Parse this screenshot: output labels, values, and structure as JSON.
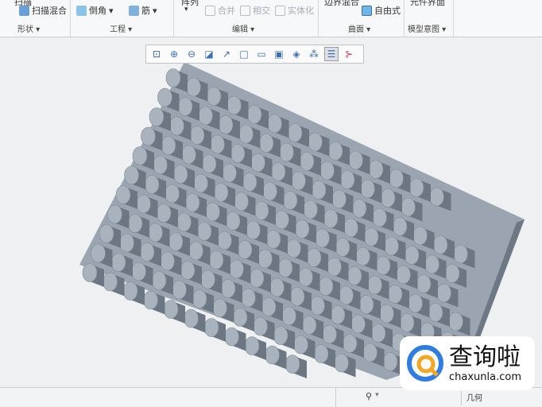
{
  "ribbon": {
    "partial_top_left": "扫描",
    "sweep_blend": "扫描混合",
    "round": "倒角",
    "rib": "筋",
    "pattern": "阵列",
    "merge": "合并",
    "intersect": "相交",
    "solidify": "实体化",
    "freestyle": "自由式",
    "boundary_partial": "边界混合",
    "concept_partial": "元件界面",
    "groups": {
      "shape": "形状",
      "engineering": "工程",
      "editing": "编辑",
      "surfaces": "曲面",
      "model_intent": "模型意图"
    }
  },
  "view_toolbar": {
    "icons": [
      "refit-icon",
      "zoom-in-icon",
      "zoom-out-icon",
      "repaint-icon",
      "reorient-icon",
      "display-style-icon",
      "saved-views-icon",
      "view-manager-icon",
      "perspective-icon",
      "datum-display-icon",
      "spin-center-icon",
      "annotation-icon"
    ]
  },
  "status": {
    "filter": "几何"
  },
  "watermark": {
    "name": "查询啦",
    "url": "chaxunla.com"
  },
  "colors": {
    "accent": "#3a6fb0",
    "model": "#8f9aa6"
  }
}
